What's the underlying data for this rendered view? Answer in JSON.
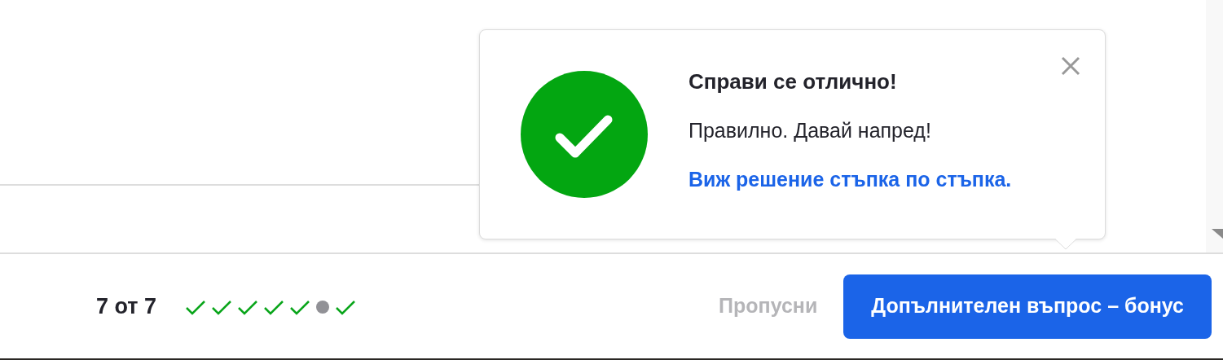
{
  "feedback": {
    "title": "Справи се отлично!",
    "message": "Правилно. Давай напред!",
    "link": "Виж решение стъпка по стъпка."
  },
  "footer": {
    "progress_text": "7 от 7",
    "progress_marks": [
      {
        "kind": "check"
      },
      {
        "kind": "check"
      },
      {
        "kind": "check"
      },
      {
        "kind": "check"
      },
      {
        "kind": "check"
      },
      {
        "kind": "dot"
      },
      {
        "kind": "check"
      }
    ],
    "skip_button": "Пропусни",
    "next_button": "Допълнителен въпрос – бонус"
  }
}
